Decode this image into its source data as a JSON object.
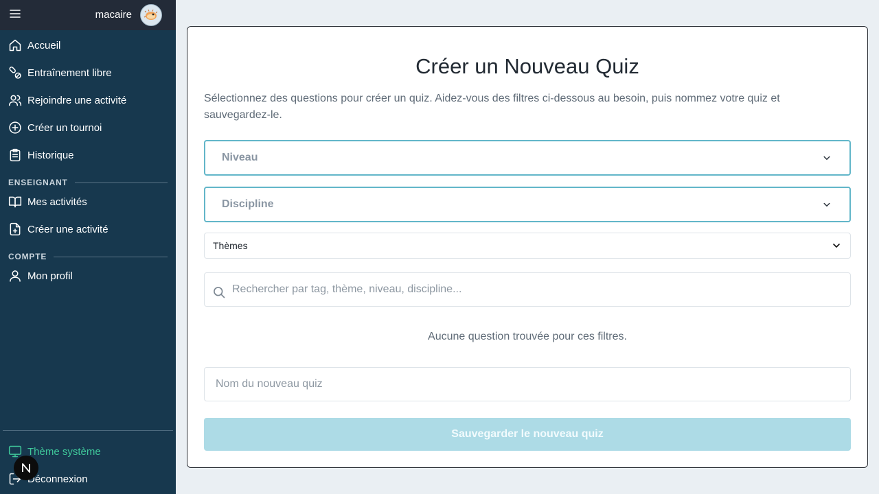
{
  "user": {
    "name": "macaire"
  },
  "sidebar": {
    "items": [
      {
        "label": "Accueil",
        "icon": "home-icon"
      },
      {
        "label": "Entraînement libre",
        "icon": "pills-icon"
      },
      {
        "label": "Rejoindre une activité",
        "icon": "users-icon"
      },
      {
        "label": "Créer un tournoi",
        "icon": "plus-circle-icon"
      },
      {
        "label": "Historique",
        "icon": "clipboard-icon"
      }
    ],
    "section_teacher": "ENSEIGNANT",
    "teacher_items": [
      {
        "label": "Mes activités",
        "icon": "book-open-icon"
      },
      {
        "label": "Créer une activité",
        "icon": "file-plus-icon"
      }
    ],
    "section_account": "COMPTE",
    "account_items": [
      {
        "label": "Mon profil",
        "icon": "user-icon"
      }
    ],
    "theme": {
      "label": "Thème système",
      "icon": "monitor-icon",
      "color": "#3fc79a"
    },
    "logout": {
      "label": "Déconnexion",
      "icon": "logout-icon"
    }
  },
  "main": {
    "title": "Créer un Nouveau Quiz",
    "description": "Sélectionnez des questions pour créer un quiz. Aidez-vous des filtres ci-dessous au besoin, puis nommez votre quiz et sauvegardez-le.",
    "filters": {
      "niveau_placeholder": "Niveau",
      "discipline_placeholder": "Discipline",
      "themes_value": "Thèmes"
    },
    "search": {
      "placeholder": "Rechercher par tag, thème, niveau, discipline..."
    },
    "empty_message": "Aucune question trouvée pour ces filtres.",
    "quiz_name": {
      "placeholder": "Nom du nouveau quiz",
      "value": ""
    },
    "save_label": "Sauvegarder le nouveau quiz"
  },
  "colors": {
    "sidebar_bg": "#17384e",
    "topbar_bg": "#232b38",
    "accent": "#62b6c9",
    "save_disabled": "#addbe6"
  }
}
